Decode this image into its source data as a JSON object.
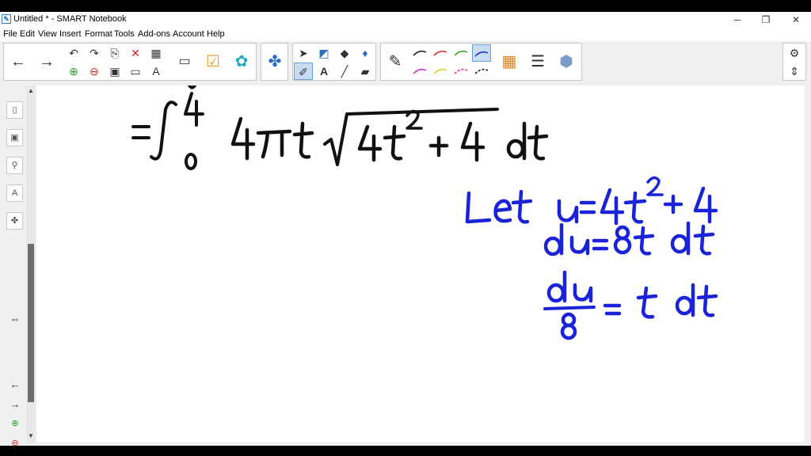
{
  "window": {
    "title": "Untitled * - SMART Notebook",
    "app_icon": "notebook-icon",
    "controls": [
      "minimize-icon",
      "restore-icon",
      "close-icon"
    ]
  },
  "menu": [
    "File",
    "Edit",
    "View",
    "Insert",
    "Format",
    "Tools",
    "Add-ons",
    "Account",
    "Help"
  ],
  "toolbar": {
    "nav": [
      "back-arrow-icon",
      "forward-arrow-icon"
    ],
    "edit": [
      "undo-icon",
      "redo-icon",
      "paste-icon",
      "delete-icon",
      "table-icon",
      "add-page-icon",
      "delete-page-icon",
      "save-icon",
      "screen-shade-icon",
      "properties-icon"
    ],
    "pens": {
      "top": [
        "#111111",
        "#d42020",
        "#2a9d2a",
        "#1a23d8"
      ],
      "bottom": [
        "#d020d0",
        "#e0d020",
        "#e020a0",
        "#111111"
      ]
    },
    "colors": {
      "accent": "#1a23d8",
      "ink_black": "#111111"
    }
  },
  "notes": {
    "equals": "=",
    "integral": "∫",
    "upper_limit": "4",
    "lower_limit": "0",
    "integrand_prefix": "4πt",
    "radicand": "4t² + 4",
    "dt": "dt",
    "let_line": "Let u = 4t² + 4",
    "du_line": "du = 8t dt",
    "frac_num": "du",
    "frac_den": "8",
    "frac_rhs": "= t dt"
  }
}
